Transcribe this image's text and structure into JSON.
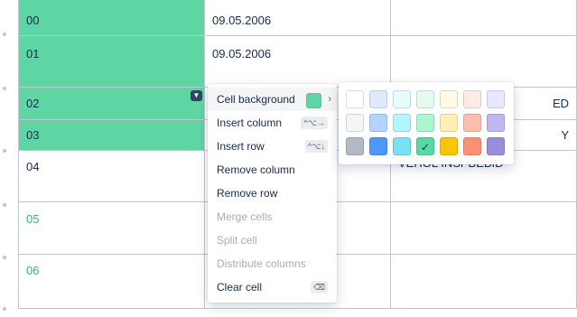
{
  "table": {
    "rows": [
      {
        "c0": "00",
        "c1": "09.05.2006",
        "c2": ""
      },
      {
        "c0": "01",
        "c1": "09.05.2006",
        "c2": ""
      },
      {
        "c0": "02",
        "c1": "",
        "c2": "ED"
      },
      {
        "c0": "03",
        "c1": "",
        "c2": "Y"
      },
      {
        "c0": "04",
        "c1": "",
        "c2": "VEHOL INSPBEBID"
      },
      {
        "c0": "05",
        "c1": "",
        "c2": ""
      },
      {
        "c0": "06",
        "c1": "",
        "c2": ""
      }
    ],
    "selected_background": "#5ed6a3",
    "green_text_color": "#36b37e"
  },
  "context_menu": {
    "cell_background": "Cell background",
    "insert_column": "Insert column",
    "insert_column_shortcut": "^⌥→",
    "insert_row": "Insert row",
    "insert_row_shortcut": "^⌥↓",
    "remove_column": "Remove column",
    "remove_row": "Remove row",
    "merge_cells": "Merge cells",
    "split_cell": "Split cell",
    "distribute_columns": "Distribute columns",
    "clear_cell": "Clear cell",
    "clear_cell_shortcut": "⌫"
  },
  "palette": {
    "colors": [
      [
        "#ffffff",
        "#deebff",
        "#e6fcff",
        "#e3fcef",
        "#fffae6",
        "#ffebe6",
        "#eae6ff"
      ],
      [
        "#f4f5f7",
        "#b3d4ff",
        "#b3f5ff",
        "#abf5d1",
        "#fff0b3",
        "#ffbdad",
        "#c0b6f2"
      ],
      [
        "#b3bac5",
        "#4c9aff",
        "#79e2f2",
        "#57d9a3",
        "#ffc400",
        "#ff8f73",
        "#998dd9"
      ]
    ],
    "selected": "#57d9a3"
  }
}
